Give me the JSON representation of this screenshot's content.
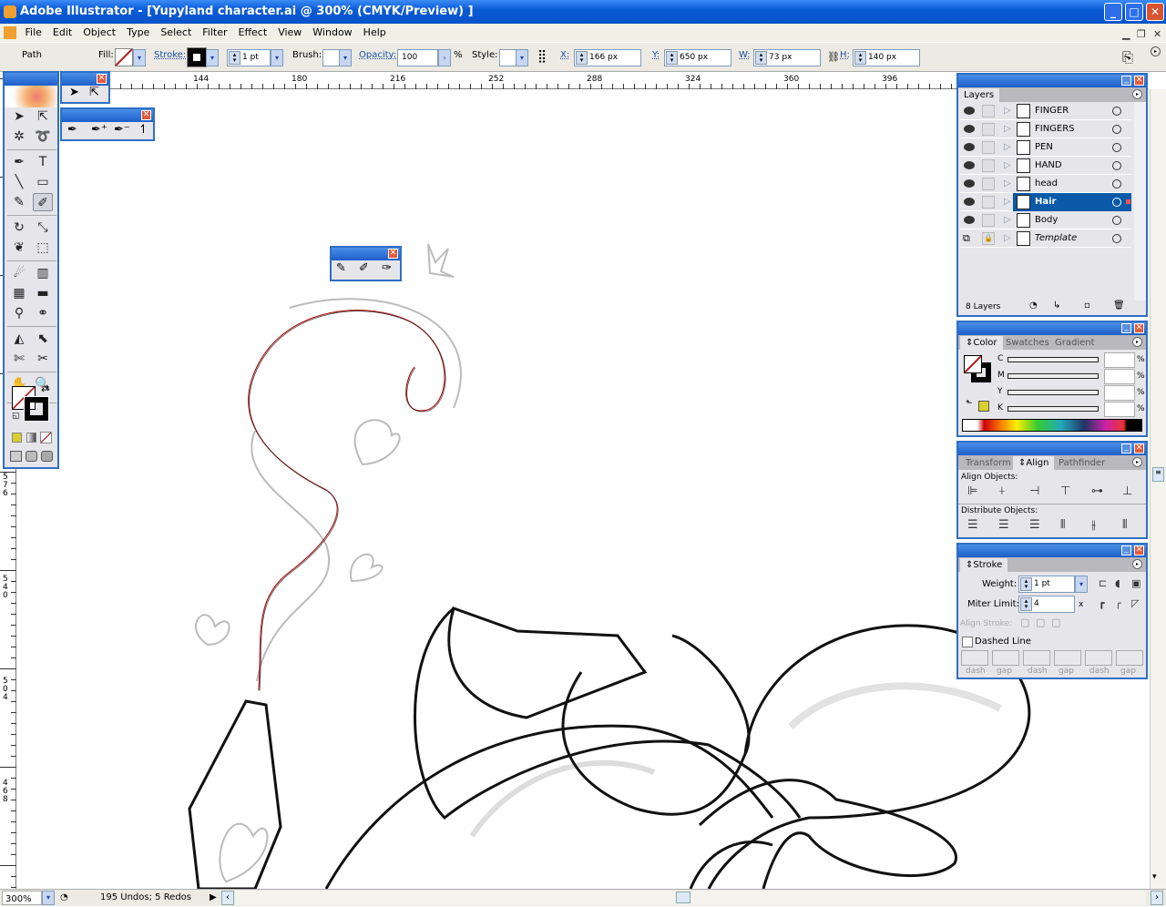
{
  "window": {
    "title": "Adobe Illustrator - [Yupyland character.ai @ 300% (CMYK/Preview) ]"
  },
  "menu": [
    "File",
    "Edit",
    "Object",
    "Type",
    "Select",
    "Filter",
    "Effect",
    "View",
    "Window",
    "Help"
  ],
  "control": {
    "selection": "Path",
    "fill_label": "Fill:",
    "stroke_label": "Stroke:",
    "stroke_weight": "1 pt",
    "brush_label": "Brush:",
    "opacity_label": "Opacity:",
    "opacity": "100",
    "opacity_unit": "%",
    "style_label": "Style:",
    "x_label": "X:",
    "x": "166 px",
    "y_label": "Y:",
    "y": "650 px",
    "w_label": "W:",
    "w": "73 px",
    "h_label": "H:",
    "h": "140 px"
  },
  "ruler": {
    "h_labels": [
      "144",
      "180",
      "216",
      "252",
      "288",
      "324",
      "360",
      "396"
    ],
    "v_labels": [
      "576",
      "540",
      "504",
      "468"
    ]
  },
  "toolbox": {
    "tools": [
      "selection-tool-icon",
      "direct-selection-tool-icon",
      "magic-wand-icon",
      "lasso-icon",
      "pen-tool-icon",
      "type-tool-icon",
      "line-tool-icon",
      "rectangle-tool-icon",
      "paintbrush-icon",
      "pencil-icon",
      "rotate-icon",
      "scale-icon",
      "warp-icon",
      "free-transform-icon",
      "symbol-sprayer-icon",
      "graph-icon",
      "mesh-icon",
      "gradient-icon",
      "eyedropper-icon",
      "blend-icon",
      "live-paint-bucket-icon",
      "live-paint-selection-icon",
      "slice-icon",
      "scissors-icon",
      "hand-icon",
      "zoom-icon"
    ],
    "tool_glyphs": [
      "➤",
      "⇱",
      "✲",
      "➰",
      "✒",
      "T",
      "╲",
      "▭",
      "✎",
      "✐",
      "↻",
      "⤡",
      "❦",
      "⬚",
      "☄",
      "▥",
      "▦",
      "▬",
      "⚲",
      "⚭",
      "◭",
      "⬉",
      "✄",
      "✂",
      "✋",
      "🔍"
    ],
    "active_tool": "pencil-icon"
  },
  "layers": {
    "tab": "Layers",
    "count": "8 Layers",
    "items": [
      {
        "name": "FINGER",
        "visible": true,
        "locked": false,
        "selected": false
      },
      {
        "name": "FINGERS",
        "visible": true,
        "locked": false,
        "selected": false
      },
      {
        "name": "PEN",
        "visible": true,
        "locked": false,
        "selected": false
      },
      {
        "name": "HAND",
        "visible": true,
        "locked": false,
        "selected": false
      },
      {
        "name": "head",
        "visible": true,
        "locked": false,
        "selected": false
      },
      {
        "name": "Hair",
        "visible": true,
        "locked": false,
        "selected": true
      },
      {
        "name": "Body",
        "visible": true,
        "locked": false,
        "selected": false
      },
      {
        "name": "Template",
        "visible": false,
        "locked": true,
        "selected": false
      }
    ]
  },
  "color": {
    "tabs": [
      "Color",
      "Swatches",
      "Gradient"
    ],
    "channels": [
      "C",
      "M",
      "Y",
      "K"
    ],
    "unit": "%",
    "last_color": "#d8cf2a"
  },
  "align": {
    "tabs": [
      "Transform",
      "Align",
      "Pathfinder"
    ],
    "align_label": "Align Objects:",
    "distribute_label": "Distribute Objects:"
  },
  "stroke": {
    "tab": "Stroke",
    "weight_label": "Weight:",
    "weight": "1 pt",
    "miter_label": "Miter Limit:",
    "miter": "4",
    "miter_unit": "x",
    "align_label": "Align Stroke:",
    "dashed_label": "Dashed Line",
    "dash_labels": [
      "dash",
      "gap",
      "dash",
      "gap",
      "dash",
      "gap"
    ]
  },
  "status": {
    "zoom": "300%",
    "history": "195 Undos; 5 Redos"
  },
  "colors": {
    "title_blue": "#0a5bd6",
    "selection": "#0a5aa8",
    "path_red": "#c0392b"
  }
}
